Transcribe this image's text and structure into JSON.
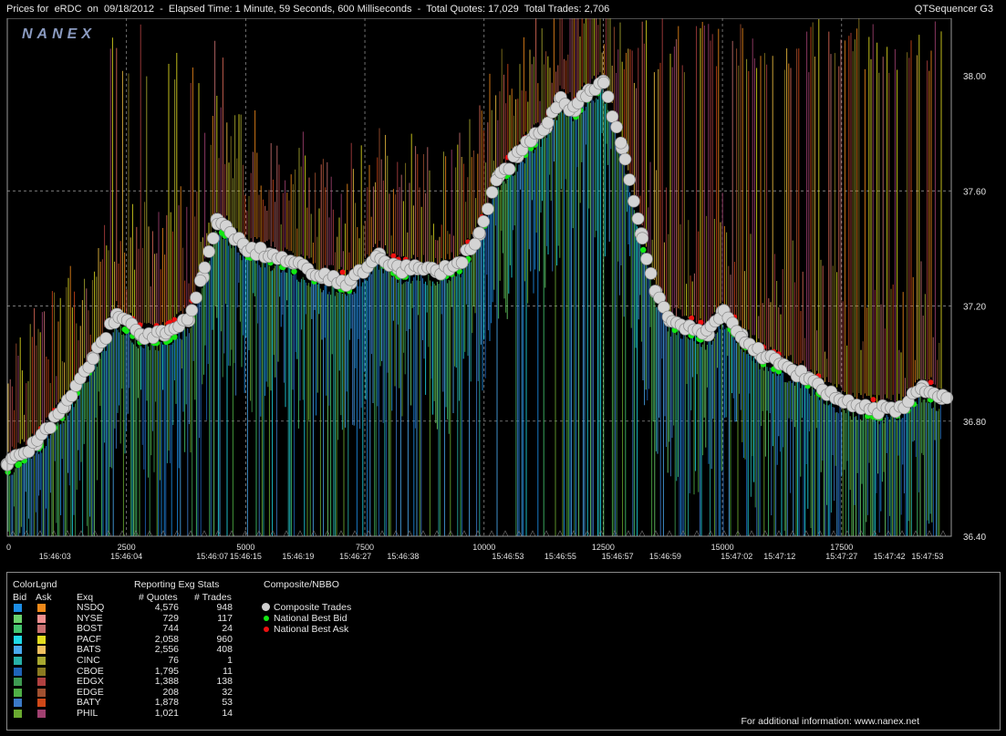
{
  "header": {
    "title": "Prices for  eRDC  on  09/18/2012  -  Elapsed Time: 1 Minute, 59 Seconds, 600 Milliseconds  -  Total Quotes: 17,029  Total Trades: 2,706",
    "app_name": "QTSequencer G3",
    "logo": "NANEX"
  },
  "chart_data": {
    "type": "line",
    "ylim": [
      36.4,
      38.2
    ],
    "xlim": [
      0,
      19800
    ],
    "y_ticks": [
      "38.00",
      "37.60",
      "37.20",
      "36.80",
      "36.40"
    ],
    "y_tick_values": [
      38.0,
      37.6,
      37.2,
      36.8,
      36.4
    ],
    "x_ticks": [
      "0",
      "2500",
      "5000",
      "7500",
      "10000",
      "12500",
      "15000",
      "17500"
    ],
    "x_tick_values": [
      0,
      2500,
      5000,
      7500,
      10000,
      12500,
      15000,
      17500
    ],
    "time_labels": [
      "15:46:03",
      "15:46:04",
      "15:46:07",
      "15:46:15",
      "15:46:19",
      "15:46:27",
      "15:46:38",
      "15:46:53",
      "15:46:55",
      "15:46:57",
      "15:46:59",
      "15:47:02",
      "15:47:12",
      "15:47:27",
      "15:47:42",
      "15:47:53"
    ],
    "time_label_seq": [
      1000,
      2500,
      4300,
      5000,
      6100,
      7300,
      8300,
      10500,
      11600,
      12800,
      13800,
      15300,
      16200,
      17500,
      18500,
      19300
    ],
    "series": [
      {
        "name": "Composite Trades",
        "x": [
          0,
          600,
          1200,
          1800,
          2300,
          2800,
          3300,
          3800,
          4100,
          4400,
          5000,
          5500,
          6000,
          6600,
          7200,
          7800,
          8200,
          8600,
          9000,
          9500,
          9900,
          10300,
          10700,
          11000,
          11300,
          11600,
          11900,
          12200,
          12500,
          12900,
          13300,
          13600,
          13900,
          14300,
          14700,
          15000,
          15400,
          15800,
          16200,
          16800,
          17400,
          17900,
          18300,
          18800,
          19200,
          19600
        ],
        "values": [
          36.65,
          36.72,
          36.85,
          37.02,
          37.17,
          37.1,
          37.1,
          37.15,
          37.3,
          37.5,
          37.4,
          37.38,
          37.35,
          37.3,
          37.28,
          37.38,
          37.33,
          37.33,
          37.32,
          37.35,
          37.45,
          37.65,
          37.72,
          37.78,
          37.82,
          37.92,
          37.88,
          37.95,
          37.98,
          37.75,
          37.45,
          37.25,
          37.15,
          37.13,
          37.1,
          37.18,
          37.1,
          37.03,
          37.0,
          36.95,
          36.88,
          36.85,
          36.84,
          36.85,
          36.92,
          36.88
        ]
      }
    ],
    "legend": [
      "Composite Trades",
      "National Best Bid",
      "National Best Ask"
    ],
    "grid": true,
    "colors": {
      "trades": "#d4d4d4",
      "best_bid": "#13e813",
      "best_ask": "#ee1111",
      "bid_palette": [
        "#1d8ee6",
        "#6bd26b",
        "#44c56e",
        "#1fd9e6",
        "#49a8ee",
        "#27b0a8",
        "#1f63b8",
        "#3e9a52",
        "#4fb046",
        "#3b7ac8",
        "#6aaa30"
      ],
      "ask_palette": [
        "#f08a1a",
        "#e06b5a",
        "#c77070",
        "#e2dc20",
        "#f0c040",
        "#a8a830",
        "#8a7a20",
        "#b04040",
        "#a05030",
        "#d04818",
        "#a04070"
      ]
    }
  },
  "legend_panel": {
    "color_legend_title": "ColorLgnd",
    "bid_label": "Bid",
    "ask_label": "Ask",
    "exq_label": "Exq",
    "stats_title": "Reporting Exg Stats",
    "quotes_header": "# Quotes",
    "trades_header": "# Trades",
    "composite_title": "Composite/NBBO",
    "composite_items": [
      {
        "label": "Composite Trades",
        "color": "#cfcfcf"
      },
      {
        "label": "National Best Bid",
        "color": "#13e813"
      },
      {
        "label": "National Best Ask",
        "color": "#ee1111"
      }
    ],
    "exchanges": [
      {
        "name": "NSDQ",
        "quotes": "4,576",
        "trades": "948",
        "bid_color": "#1d8ee6",
        "ask_color": "#f08a1a"
      },
      {
        "name": "NYSE",
        "quotes": "729",
        "trades": "117",
        "bid_color": "#6bd26b",
        "ask_color": "#f09090"
      },
      {
        "name": "BOST",
        "quotes": "744",
        "trades": "24",
        "bid_color": "#44c56e",
        "ask_color": "#c77070"
      },
      {
        "name": "PACF",
        "quotes": "2,058",
        "trades": "960",
        "bid_color": "#1fd9e6",
        "ask_color": "#e2dc20"
      },
      {
        "name": "BATS",
        "quotes": "2,556",
        "trades": "408",
        "bid_color": "#49a8ee",
        "ask_color": "#f0c060"
      },
      {
        "name": "CINC",
        "quotes": "76",
        "trades": "1",
        "bid_color": "#27b0a8",
        "ask_color": "#a8a830"
      },
      {
        "name": "CBOE",
        "quotes": "1,795",
        "trades": "11",
        "bid_color": "#1f63b8",
        "ask_color": "#8a7a20"
      },
      {
        "name": "EDGX",
        "quotes": "1,388",
        "trades": "138",
        "bid_color": "#3e9a52",
        "ask_color": "#b04040"
      },
      {
        "name": "EDGE",
        "quotes": "208",
        "trades": "32",
        "bid_color": "#4fb046",
        "ask_color": "#a05030"
      },
      {
        "name": "BATY",
        "quotes": "1,878",
        "trades": "53",
        "bid_color": "#3b7ac8",
        "ask_color": "#d04818"
      },
      {
        "name": "PHIL",
        "quotes": "1,021",
        "trades": "14",
        "bid_color": "#6aaa30",
        "ask_color": "#a04070"
      }
    ],
    "footer": "For additional information: www.nanex.net"
  }
}
